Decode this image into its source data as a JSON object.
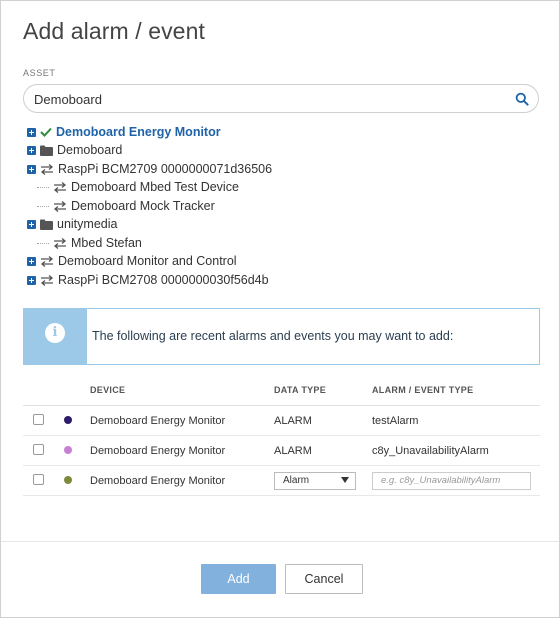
{
  "dialog": {
    "title": "Add alarm / event",
    "asset_label": "ASSET",
    "search": {
      "value": "Demoboard",
      "placeholder": ""
    }
  },
  "tree": [
    {
      "label": "Demoboard Energy Monitor",
      "expandable": true,
      "icon": "check-icon",
      "selected": true
    },
    {
      "label": "Demoboard",
      "expandable": true,
      "icon": "folder-icon"
    },
    {
      "label": "RaspPi BCM2709 0000000071d36506",
      "expandable": true,
      "icon": "exchange-icon"
    },
    {
      "label": "Demoboard Mbed Test Device",
      "expandable": false,
      "icon": "exchange-icon"
    },
    {
      "label": "Demoboard Mock Tracker",
      "expandable": false,
      "icon": "exchange-icon"
    },
    {
      "label": "unitymedia",
      "expandable": true,
      "icon": "folder-icon"
    },
    {
      "label": "Mbed Stefan",
      "expandable": false,
      "icon": "exchange-icon"
    },
    {
      "label": "Demoboard Monitor and Control",
      "expandable": true,
      "icon": "exchange-icon"
    },
    {
      "label": "RaspPi BCM2708 0000000030f56d4b",
      "expandable": true,
      "icon": "exchange-icon"
    }
  ],
  "banner": {
    "message": "The following are recent alarms and events you may want to add:",
    "icon": "info-icon"
  },
  "table": {
    "headers": [
      "DEVICE",
      "DATA TYPE",
      "ALARM / EVENT TYPE"
    ],
    "rows": [
      {
        "device": "Demoboard Energy Monitor",
        "data_type": "ALARM",
        "event_type": "testAlarm",
        "color": "#2d1b6b"
      },
      {
        "device": "Demoboard Energy Monitor",
        "data_type": "ALARM",
        "event_type": "c8y_UnavailabilityAlarm",
        "color": "#c77fd4"
      }
    ],
    "new_row": {
      "device": "Demoboard Energy Monitor",
      "data_type_value": "Alarm",
      "event_placeholder": "e.g. c8y_UnavailabilityAlarm",
      "color": "#7d8a3a"
    }
  },
  "footer": {
    "add_label": "Add",
    "cancel_label": "Cancel"
  },
  "colors": {
    "accent": "#1e62a8",
    "info": "#9cc9e8",
    "add_button": "#83b1dd"
  }
}
